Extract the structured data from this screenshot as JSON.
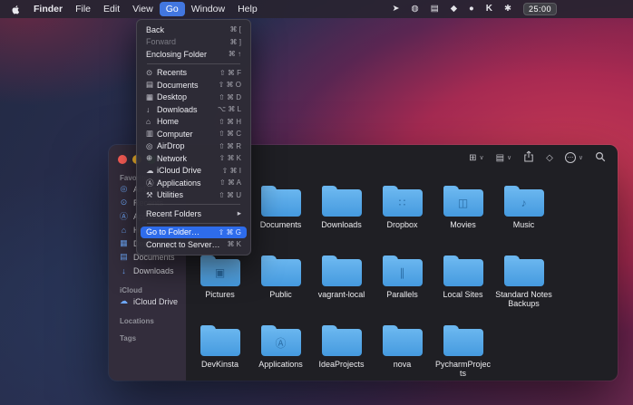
{
  "menubar": {
    "items": [
      "Finder",
      "File",
      "Edit",
      "View",
      "Go",
      "Window",
      "Help"
    ],
    "active_item": "Go",
    "status": {
      "icons": [
        {
          "name": "send-icon",
          "glyph": "➤"
        },
        {
          "name": "dot-circle-icon",
          "glyph": "◍"
        },
        {
          "name": "rows-icon",
          "glyph": "▤"
        },
        {
          "name": "bell-icon",
          "glyph": "◆"
        },
        {
          "name": "user-icon",
          "glyph": "●"
        },
        {
          "name": "keybase-icon",
          "glyph": "K"
        },
        {
          "name": "asterisk-icon",
          "glyph": "✱"
        }
      ],
      "timer": "25:00"
    }
  },
  "go_menu": {
    "nav": [
      {
        "label": "Back",
        "shortcut": "⌘ ["
      },
      {
        "label": "Forward",
        "shortcut": "⌘ ]"
      },
      {
        "label": "Enclosing Folder",
        "shortcut": "⌘ ↑"
      }
    ],
    "places": [
      {
        "icon": "⊙",
        "label": "Recents",
        "shortcut": "⇧ ⌘ F"
      },
      {
        "icon": "▤",
        "label": "Documents",
        "shortcut": "⇧ ⌘ O"
      },
      {
        "icon": "▦",
        "label": "Desktop",
        "shortcut": "⇧ ⌘ D"
      },
      {
        "icon": "↓",
        "label": "Downloads",
        "shortcut": "⌥ ⌘ L"
      },
      {
        "icon": "⌂",
        "label": "Home",
        "shortcut": "⇧ ⌘ H"
      },
      {
        "icon": "▥",
        "label": "Computer",
        "shortcut": "⇧ ⌘ C"
      },
      {
        "icon": "◎",
        "label": "AirDrop",
        "shortcut": "⇧ ⌘ R"
      },
      {
        "icon": "⊕",
        "label": "Network",
        "shortcut": "⇧ ⌘ K"
      },
      {
        "icon": "☁",
        "label": "iCloud Drive",
        "shortcut": "⇧ ⌘ I"
      },
      {
        "icon": "Ⓐ",
        "label": "Applications",
        "shortcut": "⇧ ⌘ A"
      },
      {
        "icon": "⚒",
        "label": "Utilities",
        "shortcut": "⇧ ⌘ U"
      }
    ],
    "recent": {
      "label": "Recent Folders",
      "submenu_glyph": "▸"
    },
    "actions": [
      {
        "label": "Go to Folder…",
        "shortcut": "⇧ ⌘ G",
        "state": "highlighted"
      },
      {
        "label": "Connect to Server…",
        "shortcut": "⌘ K",
        "state": "normal"
      }
    ]
  },
  "finder_window": {
    "sidebar": {
      "headers": {
        "favorites": "Favorites",
        "icloud": "iCloud",
        "locations": "Locations",
        "tags": "Tags"
      },
      "favorites": [
        {
          "icon": "◎",
          "label": "AirDrop"
        },
        {
          "icon": "⊙",
          "label": "Recents"
        },
        {
          "icon": "Ⓐ",
          "label": "Applications"
        },
        {
          "icon": "⌂",
          "label": "Home"
        },
        {
          "icon": "▦",
          "label": "Desktop"
        },
        {
          "icon": "▤",
          "label": "Documents"
        },
        {
          "icon": "↓",
          "label": "Downloads"
        }
      ],
      "icloud_items": [
        {
          "icon": "☁",
          "label": "iCloud Drive"
        }
      ]
    },
    "toolbar": {
      "view_grid_glyph": "⊞",
      "view_list_glyph": "▤",
      "chevron_glyph": "∨",
      "tag_glyph": "◇",
      "more_glyph": "⋯"
    },
    "grid_rows": [
      [
        {
          "label": "Documents",
          "glyph": ""
        },
        {
          "label": "Downloads",
          "glyph": ""
        },
        {
          "label": "Dropbox",
          "glyph": "∷"
        },
        {
          "label": "Movies",
          "glyph": "◫"
        },
        {
          "label": "Music",
          "glyph": "♪"
        }
      ],
      [
        {
          "label": "Pictures",
          "glyph": "▣"
        },
        {
          "label": "Public",
          "glyph": ""
        },
        {
          "label": "vagrant-local",
          "glyph": ""
        },
        {
          "label": "Parallels",
          "glyph": "∥"
        },
        {
          "label": "Local Sites",
          "glyph": ""
        },
        {
          "label": "Standard Notes Backups",
          "glyph": ""
        }
      ],
      [
        {
          "label": "DevKinsta",
          "glyph": ""
        },
        {
          "label": "Applications",
          "glyph": "Ⓐ"
        },
        {
          "label": "IdeaProjects",
          "glyph": ""
        },
        {
          "label": "nova",
          "glyph": ""
        },
        {
          "label": "PycharmProjects",
          "glyph": ""
        }
      ]
    ]
  }
}
